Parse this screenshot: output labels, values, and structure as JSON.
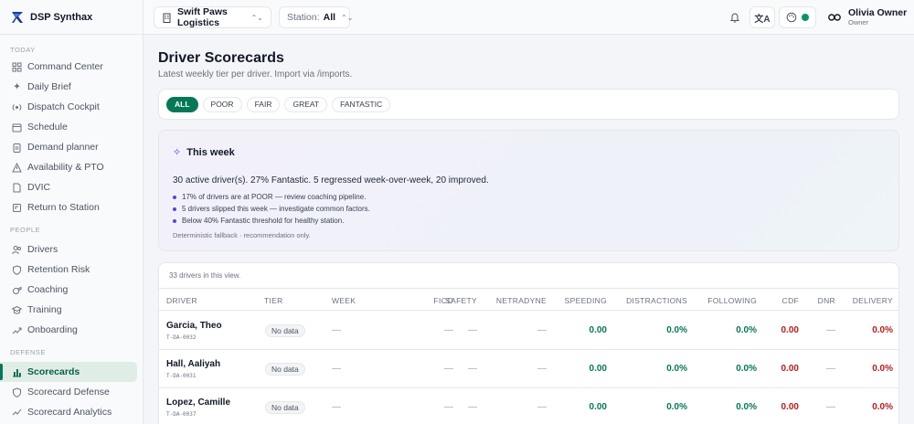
{
  "brand": {
    "name": "DSP Synthax"
  },
  "sidebar": {
    "sections": [
      {
        "label": "TODAY",
        "items": [
          {
            "label": "Command Center",
            "icon": "grid-icon"
          },
          {
            "label": "Daily Brief",
            "icon": "sparkles-icon"
          },
          {
            "label": "Dispatch Cockpit",
            "icon": "radio-icon"
          },
          {
            "label": "Schedule",
            "icon": "calendar-icon"
          },
          {
            "label": "Demand planner",
            "icon": "clipboard-icon"
          },
          {
            "label": "Availability & PTO",
            "icon": "alert-icon"
          },
          {
            "label": "DVIC",
            "icon": "file-icon"
          },
          {
            "label": "Return to Station",
            "icon": "return-icon"
          }
        ]
      },
      {
        "label": "PEOPLE",
        "items": [
          {
            "label": "Drivers",
            "icon": "users-icon"
          },
          {
            "label": "Retention Risk",
            "icon": "shield-icon"
          },
          {
            "label": "Coaching",
            "icon": "whistle-icon"
          },
          {
            "label": "Training",
            "icon": "graduation-icon"
          },
          {
            "label": "Onboarding",
            "icon": "onboarding-icon"
          }
        ]
      },
      {
        "label": "DEFENSE",
        "items": [
          {
            "label": "Scorecards",
            "icon": "bar-chart-icon",
            "active": true
          },
          {
            "label": "Scorecard Defense",
            "icon": "shield-icon"
          },
          {
            "label": "Scorecard Analytics",
            "icon": "analytics-icon"
          }
        ]
      }
    ]
  },
  "topbar": {
    "org": "Swift Paws Logistics",
    "station_label": "Station:",
    "station_value": "All",
    "user_name": "Olivia Owner",
    "user_role": "Owner"
  },
  "page": {
    "title": "Driver Scorecards",
    "subtitle": "Latest weekly tier per driver. Import via /imports."
  },
  "filters": [
    "ALL",
    "POOR",
    "FAIR",
    "GREAT",
    "FANTASTIC"
  ],
  "week": {
    "title": "This week",
    "summary": "30 active driver(s). 27% Fantastic. 5 regressed week-over-week, 20 improved.",
    "bullets": [
      "17% of drivers are at POOR — review coaching pipeline.",
      "5 drivers slipped this week — investigate common factors.",
      "Below 40% Fantastic threshold for healthy station."
    ],
    "note": "Deterministic fallback · recommendation only."
  },
  "table": {
    "count": "33 drivers in this view.",
    "columns": [
      "DRIVER",
      "TIER",
      "WEEK",
      "FICO",
      "SAFETY",
      "NETRADYNE",
      "SPEEDING",
      "DISTRACTIONS",
      "FOLLOWING",
      "CDF",
      "DNR",
      "DELIVERY"
    ],
    "rows": [
      {
        "name": "Garcia, Theo",
        "id": "T-DA-0032",
        "tier": "No data",
        "week": "—",
        "fico": "—",
        "safety": "—",
        "netradyne": "—",
        "speeding": "0.00",
        "distractions": "0.0%",
        "following": "0.0%",
        "cdf": "0.00",
        "dnr": "—",
        "delivery": "0.0%"
      },
      {
        "name": "Hall, Aaliyah",
        "id": "T-DA-0031",
        "tier": "No data",
        "week": "—",
        "fico": "—",
        "safety": "—",
        "netradyne": "—",
        "speeding": "0.00",
        "distractions": "0.0%",
        "following": "0.0%",
        "cdf": "0.00",
        "dnr": "—",
        "delivery": "0.0%"
      },
      {
        "name": "Lopez, Camille",
        "id": "T-DA-0037",
        "tier": "No data",
        "week": "—",
        "fico": "—",
        "safety": "—",
        "netradyne": "—",
        "speeding": "0.00",
        "distractions": "0.0%",
        "following": "0.0%",
        "cdf": "0.00",
        "dnr": "—",
        "delivery": "0.0%"
      }
    ]
  }
}
